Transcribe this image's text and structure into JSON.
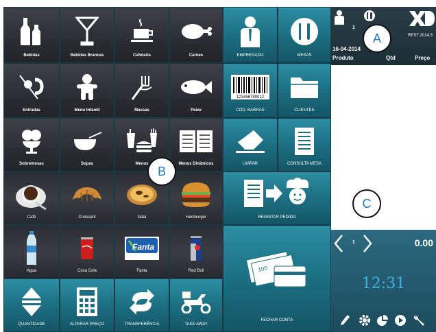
{
  "tiles": {
    "bebidas": "Bebidas",
    "bebidas_brancas": "Bebidas Brancas",
    "cafetaria": "Cafetaria",
    "carnes": "Carnes",
    "empregado": "EMPREGADO",
    "mesas": "MESAS",
    "entradas": "Entradas",
    "menu_infantil": "Menu Infantil",
    "massas": "Massas",
    "peixe": "Peixe",
    "cod_barras": "CÓD. BARRAS",
    "clientes": "CLIENTES",
    "sobremesas": "Sobremesas",
    "sopas": "Sopas",
    "menus": "Menus",
    "menus_dinamicos": "Menus Dinâmicos",
    "limpar": "LIMPAR",
    "consulta_mesa": "CONSULTA MESA",
    "cafe": "Café",
    "croissant": "Croissant",
    "nata": "Nata",
    "hamburger": "Hamburger",
    "registar_pedido": "REGISTAR PEDIDO",
    "agua": "Agua",
    "coca_cola": "Coca Cola",
    "fanta": "Fanta",
    "red_bull": "Red Bull",
    "fechar_conta": "FECHAR CONTA",
    "quantidade": "QUANTIDADE",
    "alterar_preco": "ALTERAR PREÇO",
    "transferencia": "TRANSFERÊNCIA",
    "take_away": "TAKE AWAY"
  },
  "barcode_number": "123456789012",
  "right_panel": {
    "waiter_count": "1",
    "logo_text": "REST 2014.3",
    "date": "16-04-2014",
    "col_produto": "Produto",
    "col_qtd": "Qtd",
    "col_preco": "Preço",
    "page_number": "1",
    "total": "0.00",
    "clock": "12:31"
  },
  "callouts": {
    "a": "A",
    "b": "B",
    "c": "C"
  },
  "colors": {
    "dark_tile": "#2c2f35",
    "teal_tile": "#1c6f82",
    "clock": "#3fb0e0",
    "callout_text": "#1c7ac7"
  }
}
